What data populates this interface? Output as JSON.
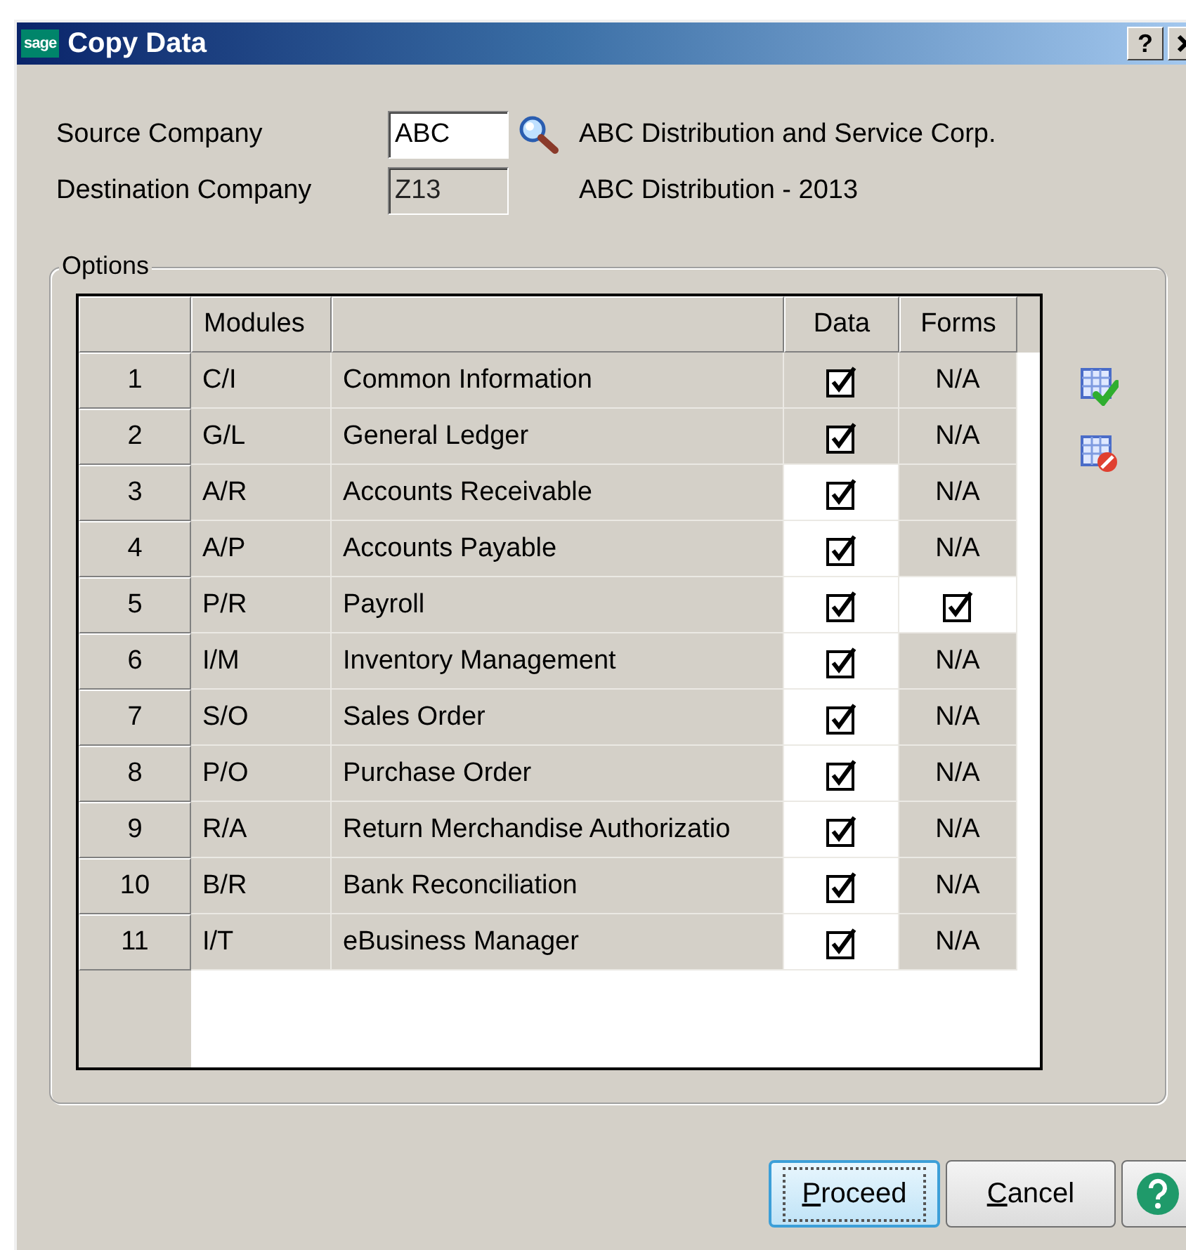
{
  "window": {
    "logo_text": "sage",
    "title": "Copy Data",
    "help_button": "?"
  },
  "source": {
    "label": "Source Company",
    "value": "ABC",
    "description": "ABC Distribution and Service Corp."
  },
  "destination": {
    "label": "Destination Company",
    "value": "Z13",
    "description": "ABC Distribution - 2013"
  },
  "options": {
    "title": "Options",
    "columns": [
      "Modules",
      "Data",
      "Forms"
    ],
    "rows": [
      {
        "number": "1",
        "module": "C/I",
        "name": "Common Information",
        "data": {
          "checked": true,
          "editable": false
        },
        "forms": {
          "kind": "text",
          "text": "N/A"
        }
      },
      {
        "number": "2",
        "module": "G/L",
        "name": "General Ledger",
        "data": {
          "checked": true,
          "editable": false
        },
        "forms": {
          "kind": "text",
          "text": "N/A"
        }
      },
      {
        "number": "3",
        "module": "A/R",
        "name": "Accounts Receivable",
        "data": {
          "checked": true,
          "editable": true
        },
        "forms": {
          "kind": "text",
          "text": "N/A"
        }
      },
      {
        "number": "4",
        "module": "A/P",
        "name": "Accounts Payable",
        "data": {
          "checked": true,
          "editable": true
        },
        "forms": {
          "kind": "text",
          "text": "N/A"
        }
      },
      {
        "number": "5",
        "module": "P/R",
        "name": "Payroll",
        "data": {
          "checked": true,
          "editable": true
        },
        "forms": {
          "kind": "checkbox",
          "checked": true
        }
      },
      {
        "number": "6",
        "module": "I/M",
        "name": "Inventory Management",
        "data": {
          "checked": true,
          "editable": true
        },
        "forms": {
          "kind": "text",
          "text": "N/A"
        }
      },
      {
        "number": "7",
        "module": "S/O",
        "name": "Sales Order",
        "data": {
          "checked": true,
          "editable": true
        },
        "forms": {
          "kind": "text",
          "text": "N/A"
        }
      },
      {
        "number": "8",
        "module": "P/O",
        "name": "Purchase Order",
        "data": {
          "checked": true,
          "editable": true
        },
        "forms": {
          "kind": "text",
          "text": "N/A"
        }
      },
      {
        "number": "9",
        "module": "R/A",
        "name": "Return Merchandise Authorizatio",
        "data": {
          "checked": true,
          "editable": true
        },
        "forms": {
          "kind": "text",
          "text": "N/A"
        }
      },
      {
        "number": "10",
        "module": "B/R",
        "name": "Bank Reconciliation",
        "data": {
          "checked": true,
          "editable": true
        },
        "forms": {
          "kind": "text",
          "text": "N/A"
        }
      },
      {
        "number": "11",
        "module": "I/T",
        "name": "eBusiness Manager",
        "data": {
          "checked": true,
          "editable": true
        },
        "forms": {
          "kind": "text",
          "text": "N/A"
        }
      }
    ]
  },
  "buttons": [
    {
      "label": "Proceed",
      "default": true
    },
    {
      "label": "Cancel",
      "default": false
    }
  ]
}
